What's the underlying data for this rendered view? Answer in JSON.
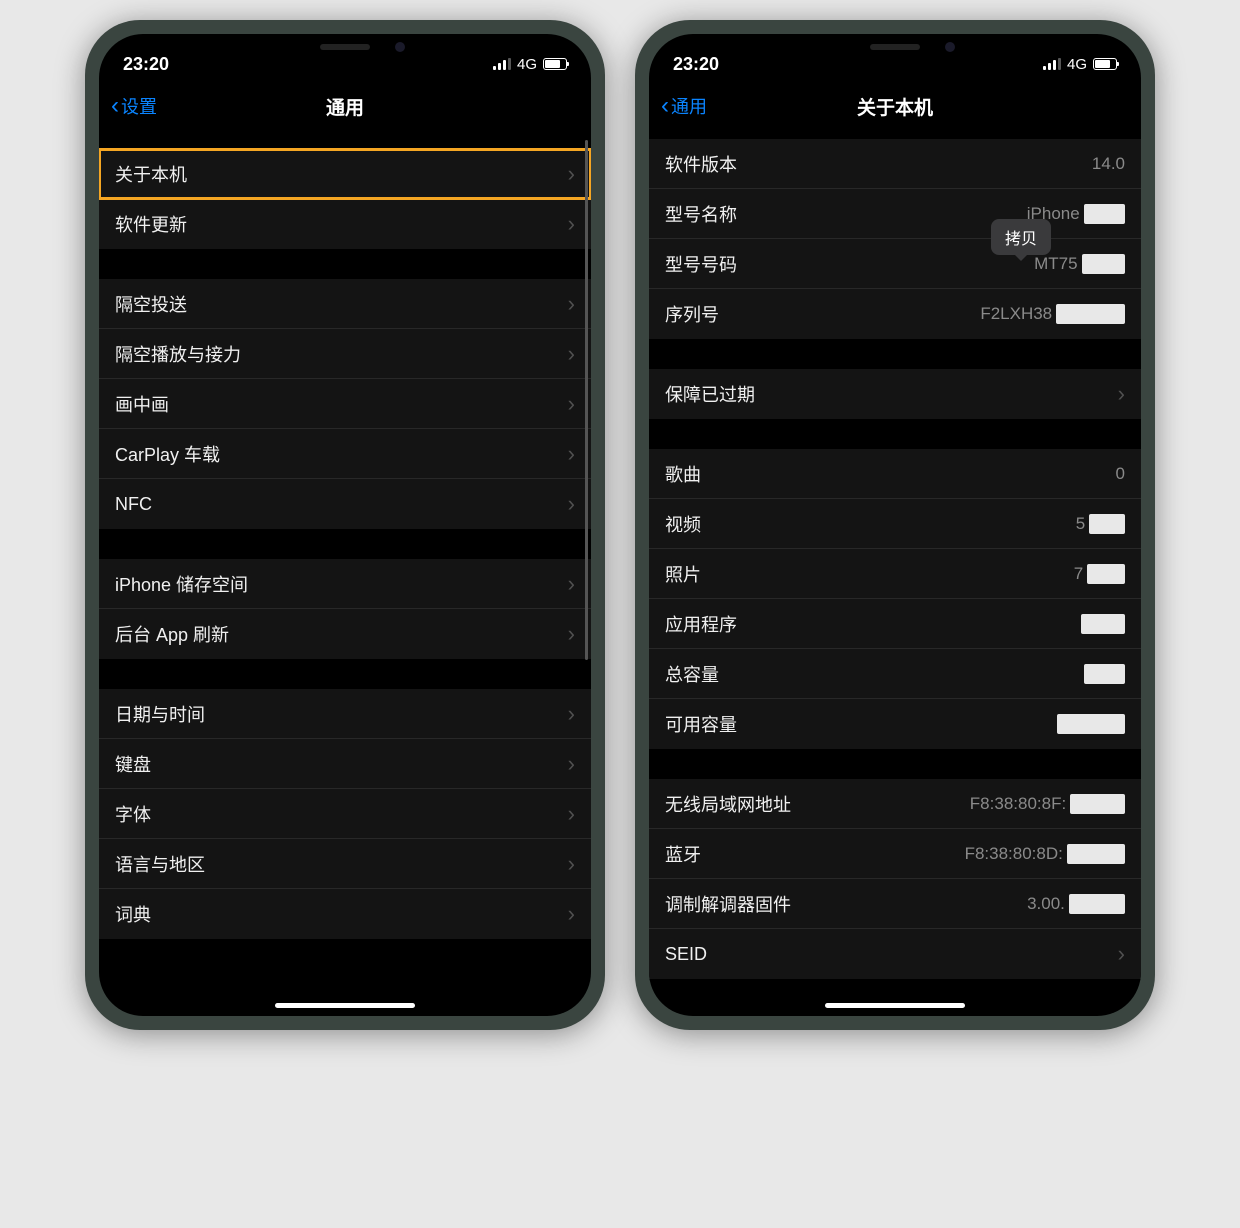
{
  "status": {
    "time": "23:20",
    "network": "4G"
  },
  "left": {
    "back": "设置",
    "title": "通用",
    "groups": [
      {
        "items": [
          {
            "label": "关于本机",
            "disclosure": true,
            "highlighted": true
          },
          {
            "label": "软件更新",
            "disclosure": true
          }
        ]
      },
      {
        "items": [
          {
            "label": "隔空投送",
            "disclosure": true
          },
          {
            "label": "隔空播放与接力",
            "disclosure": true
          },
          {
            "label": "画中画",
            "disclosure": true
          },
          {
            "label": "CarPlay 车载",
            "disclosure": true
          },
          {
            "label": "NFC",
            "disclosure": true
          }
        ]
      },
      {
        "items": [
          {
            "label": "iPhone 储存空间",
            "disclosure": true
          },
          {
            "label": "后台 App 刷新",
            "disclosure": true
          }
        ]
      },
      {
        "items": [
          {
            "label": "日期与时间",
            "disclosure": true
          },
          {
            "label": "键盘",
            "disclosure": true
          },
          {
            "label": "字体",
            "disclosure": true
          },
          {
            "label": "语言与地区",
            "disclosure": true
          },
          {
            "label": "词典",
            "disclosure": true
          }
        ]
      }
    ]
  },
  "right": {
    "back": "通用",
    "title": "关于本机",
    "tooltip": "拷贝",
    "groups": [
      {
        "items": [
          {
            "label": "软件版本",
            "value": "14.0"
          },
          {
            "label": "型号名称",
            "value": "iPhone",
            "redact_after": true
          },
          {
            "label": "型号号码",
            "value": "MT75",
            "redact_after": true,
            "tooltip": true
          },
          {
            "label": "序列号",
            "value": "F2LXH38",
            "redact_after": true
          }
        ]
      },
      {
        "items": [
          {
            "label": "保障已过期",
            "disclosure": true
          }
        ]
      },
      {
        "items": [
          {
            "label": "歌曲",
            "value": "0"
          },
          {
            "label": "视频",
            "value": "5",
            "redact_after": true
          },
          {
            "label": "照片",
            "value": "7",
            "redact_after": true
          },
          {
            "label": "应用程序",
            "value": "",
            "redact_after": true
          },
          {
            "label": "总容量",
            "value": "",
            "redact_after": true
          },
          {
            "label": "可用容量",
            "value": "",
            "redact_after": true
          }
        ]
      },
      {
        "items": [
          {
            "label": "无线局域网地址",
            "value": "F8:38:80:8F:",
            "redact_after": true
          },
          {
            "label": "蓝牙",
            "value": "F8:38:80:8D:",
            "redact_after": true
          },
          {
            "label": "调制解调器固件",
            "value": "3.00.",
            "redact_after": true
          },
          {
            "label": "SEID",
            "disclosure": true
          }
        ]
      }
    ]
  }
}
